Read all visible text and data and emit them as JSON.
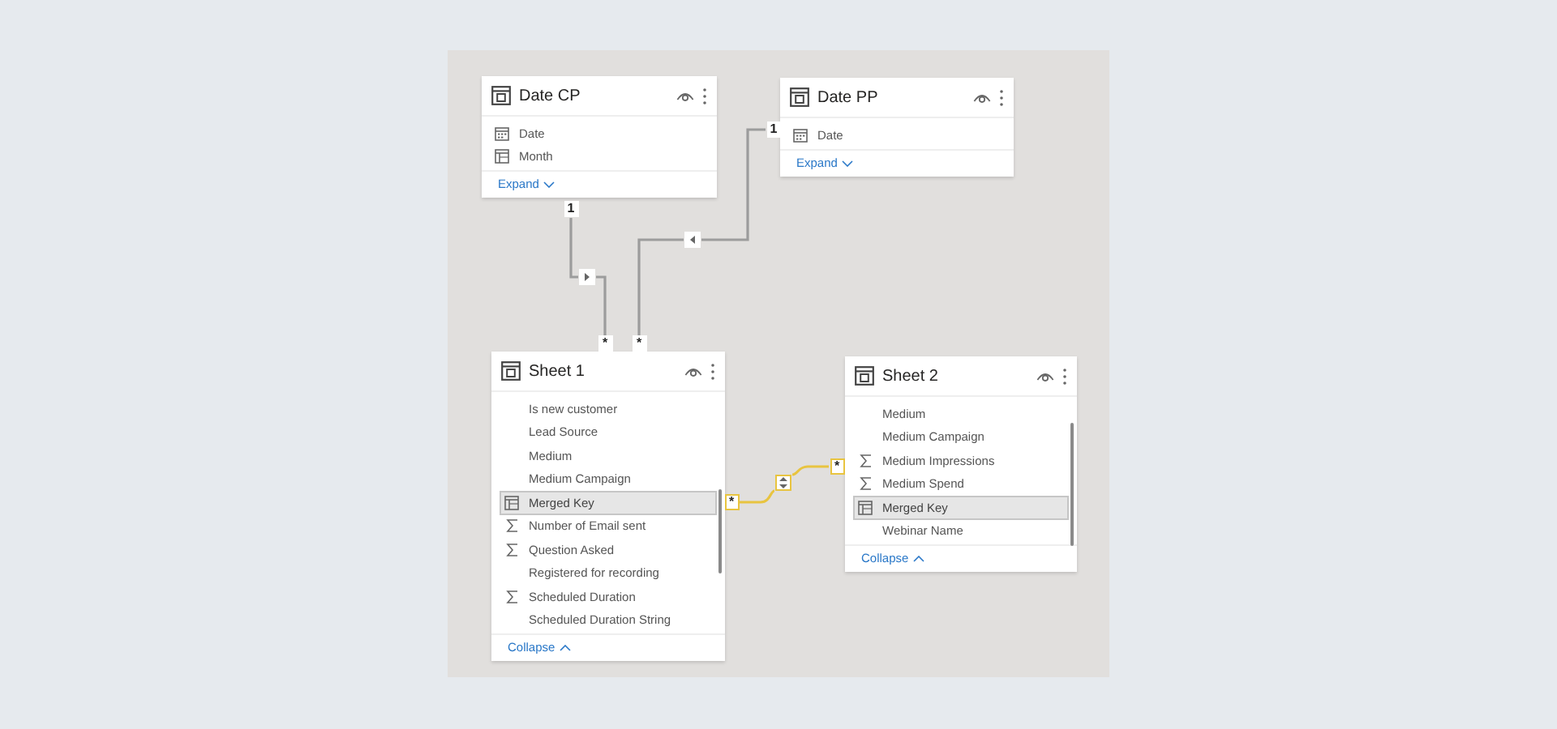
{
  "tables": [
    {
      "title": "Date CP",
      "fields": [
        {
          "label": "Date",
          "kind": "date",
          "selected": false
        },
        {
          "label": "Month",
          "kind": "hierarchy",
          "selected": false
        }
      ],
      "footer_link": "Expand",
      "expanded": false
    },
    {
      "title": "Date PP",
      "fields": [
        {
          "label": "Date",
          "kind": "date",
          "selected": false
        }
      ],
      "footer_link": "Expand",
      "expanded": false
    },
    {
      "title": "Sheet 1",
      "fields": [
        {
          "label": "Is new customer",
          "kind": "text",
          "selected": false
        },
        {
          "label": "Lead Source",
          "kind": "text",
          "selected": false
        },
        {
          "label": "Medium",
          "kind": "text",
          "selected": false
        },
        {
          "label": "Medium Campaign",
          "kind": "text",
          "selected": false
        },
        {
          "label": "Merged Key",
          "kind": "hierarchy",
          "selected": true
        },
        {
          "label": "Number of Email sent",
          "kind": "sum",
          "selected": false
        },
        {
          "label": "Question Asked",
          "kind": "sum",
          "selected": false
        },
        {
          "label": "Registered for recording",
          "kind": "text",
          "selected": false
        },
        {
          "label": "Scheduled Duration",
          "kind": "sum",
          "selected": false
        },
        {
          "label": "Scheduled Duration String",
          "kind": "text",
          "selected": false
        }
      ],
      "footer_link": "Collapse",
      "expanded": true
    },
    {
      "title": "Sheet 2",
      "fields": [
        {
          "label": "Medium",
          "kind": "text",
          "selected": false
        },
        {
          "label": "Medium Campaign",
          "kind": "text",
          "selected": false
        },
        {
          "label": "Medium Impressions",
          "kind": "sum",
          "selected": false
        },
        {
          "label": "Medium Spend",
          "kind": "sum",
          "selected": false
        },
        {
          "label": "Merged Key",
          "kind": "hierarchy",
          "selected": true
        },
        {
          "label": "Webinar Name",
          "kind": "text",
          "selected": false
        }
      ],
      "footer_link": "Collapse",
      "expanded": true
    }
  ],
  "relationships": [
    {
      "from_end": "1",
      "to_end": "*",
      "kind": "single",
      "selected": false
    },
    {
      "from_end": "1",
      "to_end": "*",
      "kind": "single",
      "selected": false
    },
    {
      "from_end": "*",
      "to_end": "*",
      "kind": "both",
      "selected": true
    }
  ]
}
